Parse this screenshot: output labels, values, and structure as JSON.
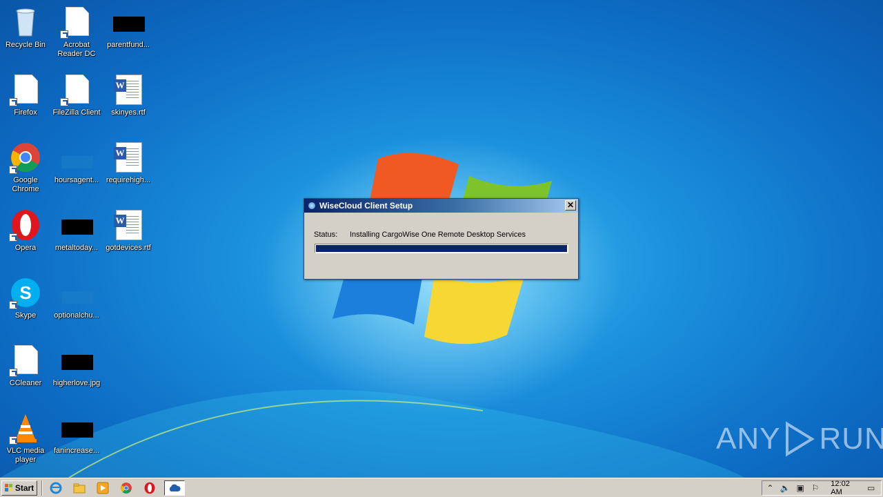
{
  "desktop": {
    "icons": [
      {
        "label": "Recycle Bin",
        "icon": "recycle-bin-icon"
      },
      {
        "label": "Acrobat Reader DC",
        "icon": "acrobat-shortcut-icon"
      },
      {
        "label": "parentfund...",
        "icon": "blacked-file-icon"
      },
      {
        "label": "Firefox",
        "icon": "firefox-shortcut-icon"
      },
      {
        "label": "FileZilla Client",
        "icon": "filezilla-shortcut-icon"
      },
      {
        "label": "skinyes.rtf",
        "icon": "word-document-icon"
      },
      {
        "label": "Google Chrome",
        "icon": "chrome-icon"
      },
      {
        "label": "hoursagent...",
        "icon": "file-icon"
      },
      {
        "label": "requirehigh...",
        "icon": "word-document-icon"
      },
      {
        "label": "Opera",
        "icon": "opera-icon"
      },
      {
        "label": "metaltoday...",
        "icon": "blacked-file-icon"
      },
      {
        "label": "gotdevices.rtf",
        "icon": "word-document-icon"
      },
      {
        "label": "Skype",
        "icon": "skype-icon"
      },
      {
        "label": "optionalchu...",
        "icon": "file-icon"
      },
      {
        "label": "CCleaner",
        "icon": "ccleaner-shortcut-icon"
      },
      {
        "label": "higherlove.jpg",
        "icon": "blacked-image-icon"
      },
      {
        "label": "VLC media player",
        "icon": "vlc-icon"
      },
      {
        "label": "fanincrease...",
        "icon": "blacked-file-icon"
      }
    ]
  },
  "dialog": {
    "title": "WiseCloud Client Setup",
    "close_glyph": "✕",
    "status_label": "Status:",
    "status_text": "Installing CargoWise One Remote Desktop Services",
    "progress": 1.0
  },
  "taskbar": {
    "start_label": "Start",
    "pinned": [
      "ie-icon",
      "explorer-icon",
      "media-player-icon",
      "chrome-icon",
      "opera-icon",
      "wisecloud-icon"
    ],
    "clock": "12:02 AM"
  },
  "watermark": {
    "left": "ANY",
    "right": "RUN"
  },
  "colors": {
    "desktop_blue": "#1a8fdc",
    "title_blue": "#0a246a",
    "progress_fill": "#0a246a"
  }
}
